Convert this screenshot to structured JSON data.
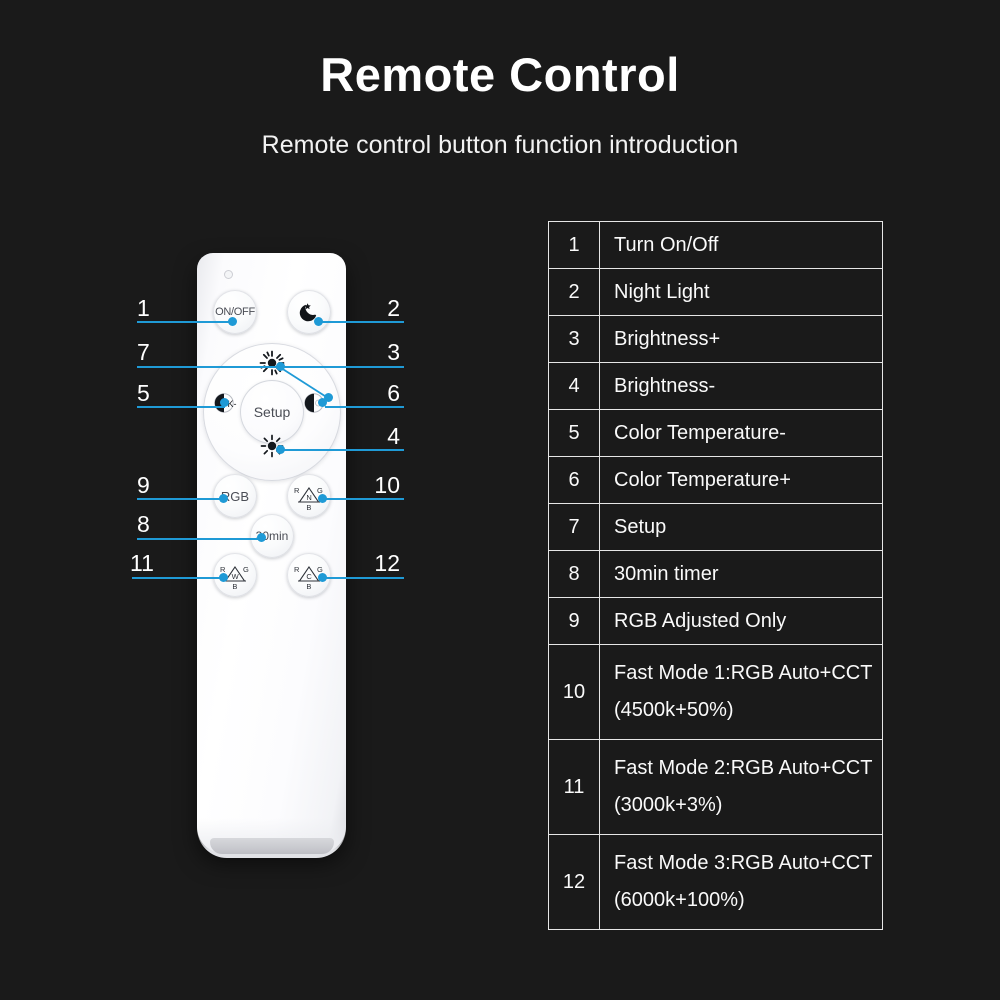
{
  "header": {
    "title": "Remote Control",
    "subtitle": "Remote control button function introduction"
  },
  "colors": {
    "background": "#1a1a1a",
    "text": "#ffffff",
    "leader_line": "#1f9ad6",
    "table_border": "#e6e6e6",
    "remote_body": "#ffffff"
  },
  "remote": {
    "buttons": {
      "on_off": "ON/OFF",
      "night_light_icon": "moon-star-icon",
      "brightness_up_icon": "sun-bright-icon",
      "brightness_down_icon": "sun-dim-icon",
      "cct_minus_label": "K-",
      "cct_plus_icon": "half-circle-icon",
      "setup": "Setup",
      "rgb": "RGB",
      "timer": "30min",
      "fast_mode_1_center": "N",
      "fast_mode_2_center": "W",
      "fast_mode_3_center": "C",
      "triangle_corner_left": "R",
      "triangle_corner_right": "G",
      "triangle_corner_bottom": "B"
    },
    "callouts_left": [
      "1",
      "7",
      "5",
      "9",
      "8",
      "11"
    ],
    "callouts_right": [
      "2",
      "3",
      "6",
      "4",
      "10",
      "12"
    ]
  },
  "table": {
    "rows": [
      {
        "num": "1",
        "label": "Turn On/Off",
        "lines": 1
      },
      {
        "num": "2",
        "label": "Night Light",
        "lines": 1
      },
      {
        "num": "3",
        "label": "Brightness+",
        "lines": 1
      },
      {
        "num": "4",
        "label": "Brightness-",
        "lines": 1
      },
      {
        "num": "5",
        "label": "Color Temperature-",
        "lines": 1
      },
      {
        "num": "6",
        "label": "Color Temperature+",
        "lines": 1
      },
      {
        "num": "7",
        "label": "Setup",
        "lines": 1
      },
      {
        "num": "8",
        "label": "30min timer",
        "lines": 1
      },
      {
        "num": "9",
        "label": "RGB Adjusted Only",
        "lines": 1
      },
      {
        "num": "10",
        "label": "Fast Mode 1:RGB Auto+CCT (4500k+50%)",
        "lines": 2
      },
      {
        "num": "11",
        "label": "Fast Mode 2:RGB Auto+CCT (3000k+3%)",
        "lines": 2
      },
      {
        "num": "12",
        "label": "Fast Mode 3:RGB Auto+CCT (6000k+100%)",
        "lines": 2
      }
    ]
  }
}
